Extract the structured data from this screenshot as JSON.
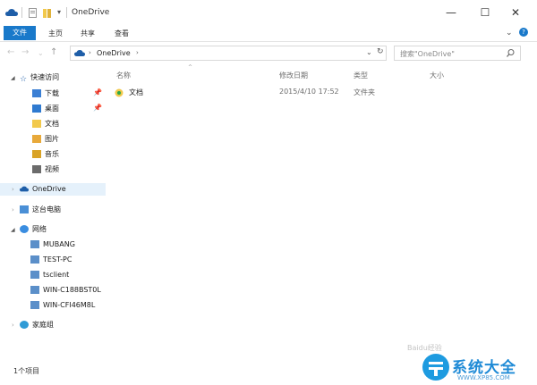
{
  "window": {
    "title": "OneDrive",
    "minimize": "—",
    "maximize": "☐",
    "close": "✕"
  },
  "ribbon": {
    "tabs": [
      "文件",
      "主页",
      "共享",
      "查看"
    ],
    "expand": "⌄",
    "help": "?"
  },
  "address": {
    "path": "OneDrive",
    "search_placeholder": "搜索\"OneDrive\""
  },
  "columns": [
    "名称",
    "修改日期",
    "类型",
    "大小"
  ],
  "files": [
    {
      "name": "文档",
      "modified": "2015/4/10 17:52",
      "type": "文件夹",
      "size": ""
    }
  ],
  "sidebar": {
    "quick_access": "快速访问",
    "quick_items": [
      "下载",
      "桌面",
      "文档",
      "图片",
      "音乐",
      "视频"
    ],
    "onedrive": "OneDrive",
    "this_pc": "这台电脑",
    "network": "网络",
    "network_items": [
      "MUBANG",
      "TEST-PC",
      "tsclient",
      "WIN-C188BST0L",
      "WIN-CFI46M8L"
    ],
    "homegroup": "家庭组"
  },
  "status": {
    "count": "1个项目"
  },
  "watermark": {
    "brand": "系统大全",
    "url": "WWW.XP85.COM",
    "baidu": "Baidu经验"
  }
}
